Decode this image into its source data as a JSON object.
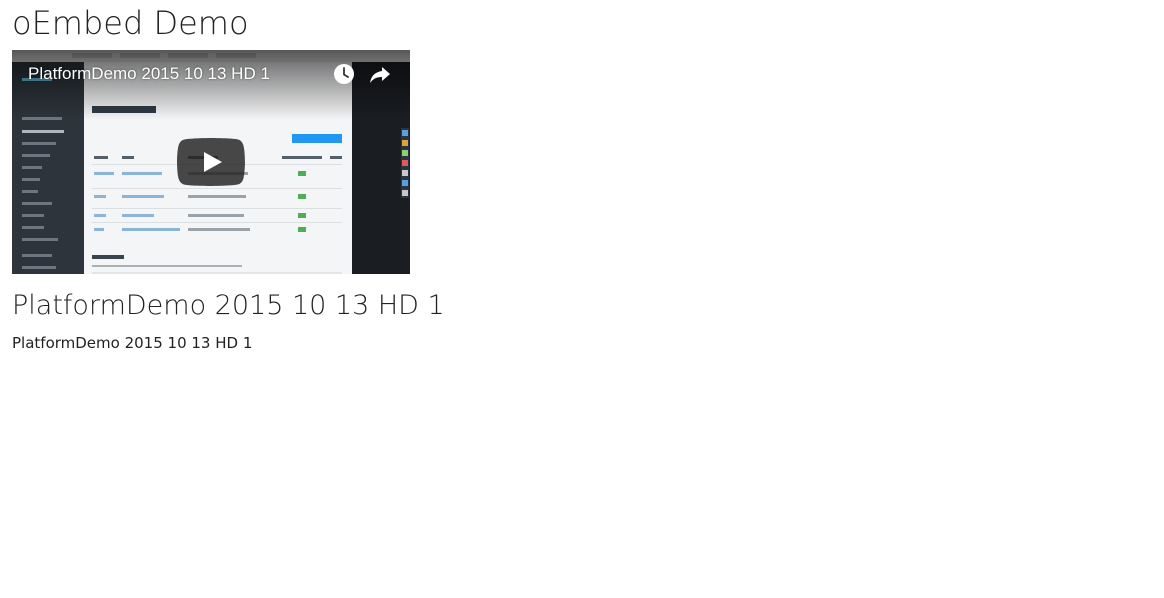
{
  "page": {
    "title": "oEmbed Demo"
  },
  "player": {
    "video_title": "PlatformDemo 2015 10 13 HD 1"
  },
  "video": {
    "heading": "PlatformDemo 2015 10 13 HD 1",
    "description": "PlatformDemo 2015 10 13 HD 1"
  },
  "icons": {
    "play": "play-icon",
    "watch_later": "clock-icon",
    "share": "share-icon"
  },
  "colors": {
    "play_button_bg": "#212121",
    "title_text": "#222222",
    "accent_blue": "#2196f3",
    "status_green": "#4caf50"
  }
}
